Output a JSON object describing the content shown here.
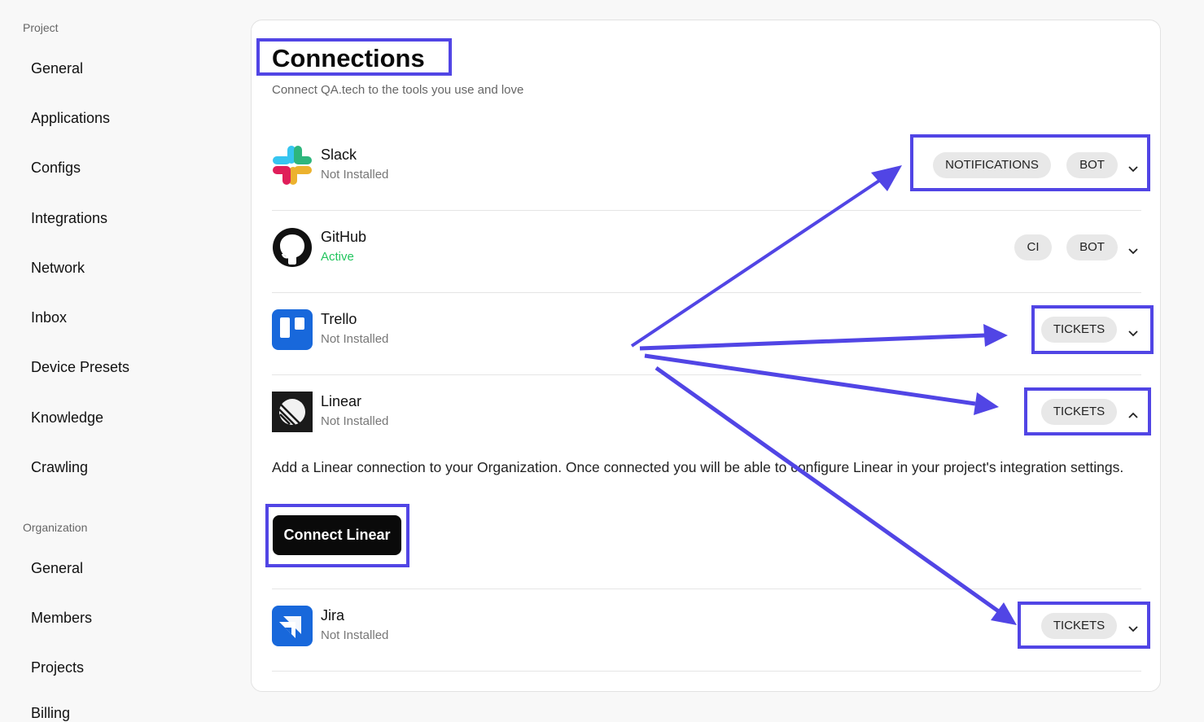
{
  "sidebar": {
    "project_label": "Project",
    "project_items": [
      "General",
      "Applications",
      "Configs",
      "Integrations",
      "Network",
      "Inbox",
      "Device Presets",
      "Knowledge",
      "Crawling"
    ],
    "organization_label": "Organization",
    "organization_items": [
      "General",
      "Members",
      "Projects",
      "Billing"
    ]
  },
  "page": {
    "title": "Connections",
    "subtitle": "Connect QA.tech to the tools you use and love"
  },
  "integrations": [
    {
      "name": "Slack",
      "status": "Not Installed",
      "tags": [
        "NOTIFICATIONS",
        "BOT"
      ],
      "expanded": false,
      "icon": "slack-logo"
    },
    {
      "name": "GitHub",
      "status": "Active",
      "tags": [
        "CI",
        "BOT"
      ],
      "expanded": false,
      "icon": "github-logo"
    },
    {
      "name": "Trello",
      "status": "Not Installed",
      "tags": [
        "TICKETS"
      ],
      "expanded": false,
      "icon": "trello-logo"
    },
    {
      "name": "Linear",
      "status": "Not Installed",
      "tags": [
        "TICKETS"
      ],
      "expanded": true,
      "icon": "linear-logo"
    },
    {
      "name": "Jira",
      "status": "Not Installed",
      "tags": [
        "TICKETS"
      ],
      "expanded": false,
      "icon": "jira-logo"
    }
  ],
  "linear_panel": {
    "description": "Add a Linear connection to your Organization. Once connected you will be able to configure Linear in your project's integration settings.",
    "button_label": "Connect Linear"
  },
  "colors": {
    "annotation": "#5145e5",
    "active": "#22c55e",
    "button": "#0a0a0a"
  }
}
